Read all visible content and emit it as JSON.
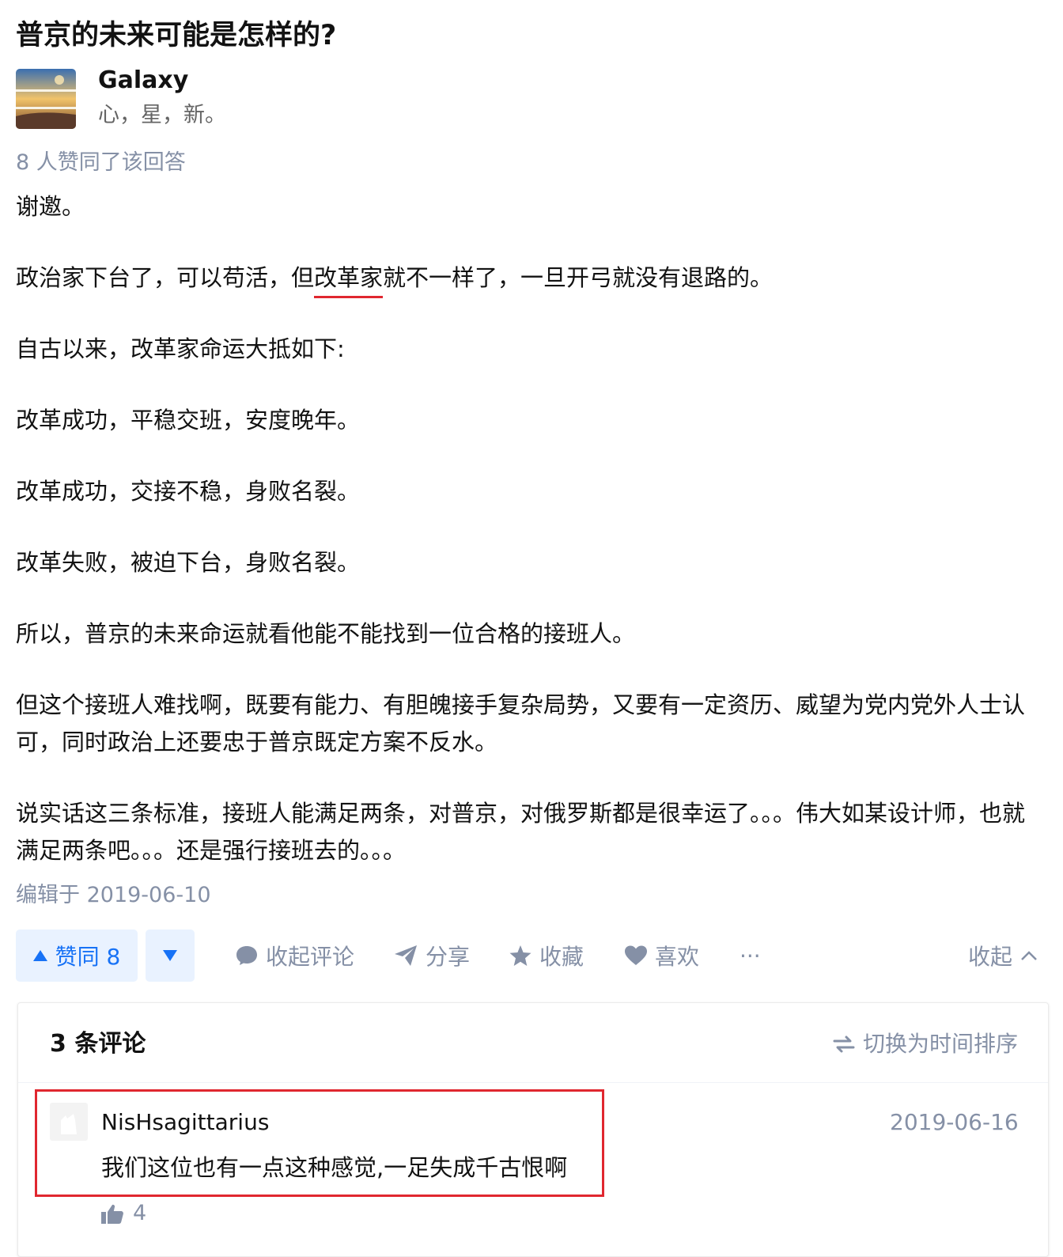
{
  "question": {
    "title": "普京的未来可能是怎样的?"
  },
  "author": {
    "name": "Galaxy",
    "bio": "心，星，新。"
  },
  "answer": {
    "vote_summary": "8 人赞同了该回答",
    "paragraphs": {
      "p0": "谢邀。",
      "p1_before": "政治家下台了，可以苟活，但",
      "p1_link": "改革家",
      "p1_after": "就不一样了，一旦开弓就没有退路的。",
      "p2": "自古以来，改革家命运大抵如下:",
      "p3": "改革成功，平稳交班，安度晚年。",
      "p4": "改革成功，交接不稳，身败名裂。",
      "p5": "改革失败，被迫下台，身败名裂。",
      "p6": "所以，普京的未来命运就看他能不能找到一位合格的接班人。",
      "p7": "但这个接班人难找啊，既要有能力、有胆魄接手复杂局势，又要有一定资历、威望为党内党外人士认可，同时政治上还要忠于普京既定方案不反水。",
      "p8": "说实话这三条标准，接班人能满足两条，对普京，对俄罗斯都是很幸运了。。。伟大如某设计师，也就满足两条吧。。。还是强行接班去的。。。"
    },
    "edit_time": "编辑于 2019-06-10"
  },
  "actions": {
    "upvote_label": "赞同 8",
    "collapse_comments": "收起评论",
    "share": "分享",
    "favorite": "收藏",
    "like": "喜欢",
    "more": "···",
    "collapse": "收起"
  },
  "comments": {
    "count_label": "3 条评论",
    "sort_toggle": "切换为时间排序",
    "items": [
      {
        "author": "NisHsagittarius",
        "date": "2019-06-16",
        "text": "我们这位也有一点这种感觉,一足失成千古恨啊",
        "likes": "4"
      }
    ]
  },
  "colors": {
    "primary": "#1772f6",
    "muted": "#8590a6",
    "highlight": "#e0272f",
    "upvote_bg": "#e9f2ff"
  }
}
